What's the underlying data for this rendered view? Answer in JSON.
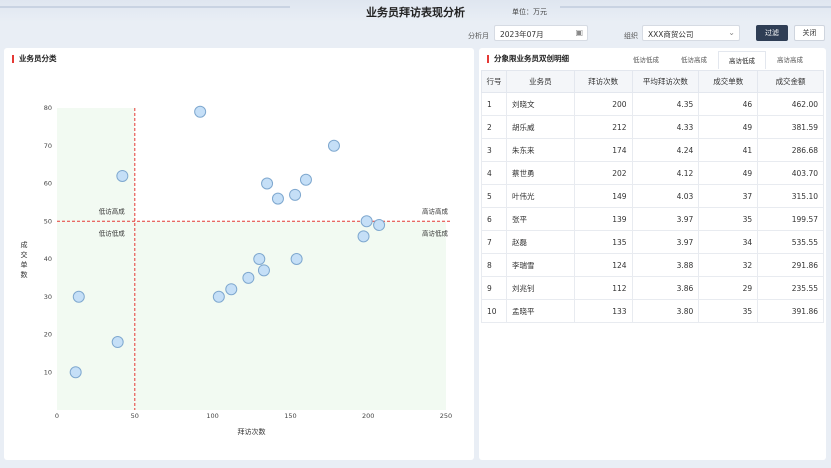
{
  "header": {
    "title": "业务员拜访表现分析",
    "unit": "单位：万元"
  },
  "filters": {
    "period_label": "分析月",
    "period_value": "2023年07月",
    "org_label": "组织",
    "org_value": "XXX商贸公司",
    "filter_btn": "过滤",
    "close_btn": "关闭"
  },
  "left_panel": {
    "title": "业务员分类"
  },
  "right_panel": {
    "title": "分象限业务员双创明细",
    "tabs": [
      "低访低成",
      "低访高成",
      "高访低成",
      "高访高成"
    ],
    "active_tab": 2
  },
  "colors": {
    "accent": "#e53935",
    "dark_button": "#2f3e55",
    "point_fill": "#c5dff7",
    "point_stroke": "#7fa8cf",
    "quadrant_fill": "#f2faf2"
  },
  "chart_data": {
    "type": "scatter",
    "xlabel": "拜访次数",
    "ylabel": "成交单数",
    "xlim": [
      0,
      250
    ],
    "ylim": [
      0,
      80
    ],
    "xticks": [
      0,
      50,
      100,
      150,
      200,
      250
    ],
    "yticks": [
      10,
      20,
      30,
      40,
      50,
      60,
      70,
      80
    ],
    "threshold_x": 50,
    "threshold_y": 50,
    "quadrant_labels": {
      "top_left": "低访高成",
      "bottom_left": "低访低成",
      "top_right": "高访高成",
      "bottom_right": "高访低成"
    },
    "points": [
      {
        "x": 12,
        "y": 10
      },
      {
        "x": 14,
        "y": 30
      },
      {
        "x": 39,
        "y": 18
      },
      {
        "x": 42,
        "y": 62
      },
      {
        "x": 92,
        "y": 79
      },
      {
        "x": 104,
        "y": 30
      },
      {
        "x": 112,
        "y": 32
      },
      {
        "x": 123,
        "y": 35
      },
      {
        "x": 130,
        "y": 40
      },
      {
        "x": 133,
        "y": 37
      },
      {
        "x": 135,
        "y": 60
      },
      {
        "x": 142,
        "y": 56
      },
      {
        "x": 153,
        "y": 57
      },
      {
        "x": 154,
        "y": 40
      },
      {
        "x": 160,
        "y": 61
      },
      {
        "x": 178,
        "y": 70
      },
      {
        "x": 197,
        "y": 46
      },
      {
        "x": 199,
        "y": 50
      },
      {
        "x": 207,
        "y": 49
      }
    ]
  },
  "table": {
    "headers": [
      "行号",
      "业务员",
      "拜访次数",
      "平均拜访次数",
      "成交单数",
      "成交金额"
    ],
    "rows": [
      [
        "1",
        "刘晓文",
        "200",
        "4.35",
        "46",
        "462.00"
      ],
      [
        "2",
        "胡乐威",
        "212",
        "4.33",
        "49",
        "381.59"
      ],
      [
        "3",
        "朱东来",
        "174",
        "4.24",
        "41",
        "286.68"
      ],
      [
        "4",
        "蔡世勇",
        "202",
        "4.12",
        "49",
        "403.70"
      ],
      [
        "5",
        "叶伟光",
        "149",
        "4.03",
        "37",
        "315.10"
      ],
      [
        "6",
        "张平",
        "139",
        "3.97",
        "35",
        "199.57"
      ],
      [
        "7",
        "赵磊",
        "135",
        "3.97",
        "34",
        "535.55"
      ],
      [
        "8",
        "李瑞雪",
        "124",
        "3.88",
        "32",
        "291.86"
      ],
      [
        "9",
        "刘兆钊",
        "112",
        "3.86",
        "29",
        "235.55"
      ],
      [
        "10",
        "孟晓平",
        "133",
        "3.80",
        "35",
        "391.86"
      ]
    ]
  }
}
